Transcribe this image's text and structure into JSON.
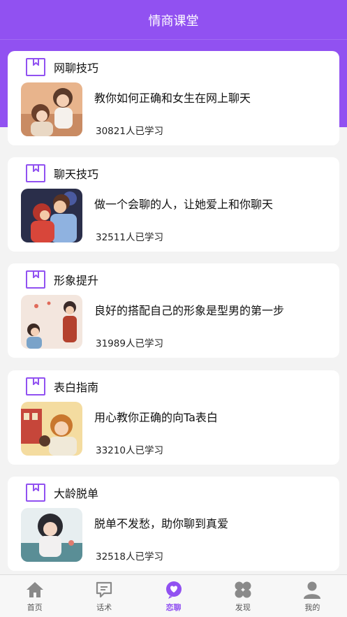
{
  "header": {
    "title": "情商课堂"
  },
  "colors": {
    "accent": "#9151f1",
    "tab_inactive": "#8a8a8a"
  },
  "courses": [
    {
      "title": "网聊技巧",
      "description": "教你如何正确和女生在网上聊天",
      "count": "30821人已学习",
      "icon": "bookmark-icon"
    },
    {
      "title": "聊天技巧",
      "description": "做一个会聊的人，让她爱上和你聊天",
      "count": "32511人已学习",
      "icon": "bookmark-icon"
    },
    {
      "title": "形象提升",
      "description": "良好的搭配自己的形象是型男的第一步",
      "count": "31989人已学习",
      "icon": "bookmark-icon"
    },
    {
      "title": "表白指南",
      "description": "用心教你正确的向Ta表白",
      "count": "33210人已学习",
      "icon": "bookmark-icon"
    },
    {
      "title": "大龄脱单",
      "description": "脱单不发愁，助你聊到真爱",
      "count": "32518人已学习",
      "icon": "bookmark-icon"
    }
  ],
  "tabbar": {
    "items": [
      {
        "label": "首页",
        "icon": "home-icon",
        "active": false
      },
      {
        "label": "话术",
        "icon": "chat-icon",
        "active": false
      },
      {
        "label": "恋聊",
        "icon": "heart-bubble-icon",
        "active": true
      },
      {
        "label": "发现",
        "icon": "clover-icon",
        "active": false
      },
      {
        "label": "我的",
        "icon": "user-icon",
        "active": false
      }
    ]
  }
}
